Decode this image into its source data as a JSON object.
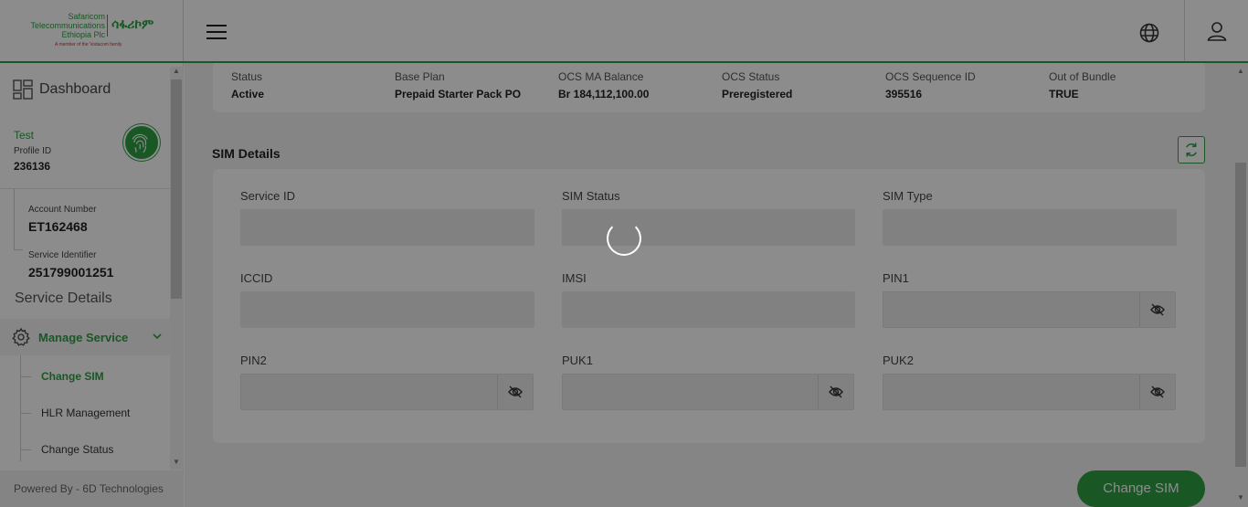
{
  "header": {
    "logo_lines": [
      "Safaricom",
      "Telecommunications",
      "Ethiopia Plc"
    ],
    "logo_amharic": "ሳፋሪኮም",
    "logo_sub": "A member of the Vodacom family",
    "menu_icon": "hamburger-icon",
    "language_icon": "globe-icon",
    "user_icon": "user-icon"
  },
  "sidebar": {
    "dashboard_label": "Dashboard",
    "profile_name": "Test",
    "profile_id_label": "Profile ID",
    "profile_id": "236136",
    "account_number_label": "Account Number",
    "account_number": "ET162468",
    "service_identifier_label": "Service Identifier",
    "service_identifier": "251799001251",
    "service_details_label": "Service Details",
    "manage_service_label": "Manage Service",
    "sub_items": [
      "Change SIM",
      "HLR Management",
      "Change Status"
    ],
    "active_sub_item": "Change SIM",
    "powered_by": "Powered By - 6D Technologies"
  },
  "summary": [
    {
      "label": "Status",
      "value": "Active"
    },
    {
      "label": "Base Plan",
      "value": "Prepaid Starter Pack PO"
    },
    {
      "label": "OCS MA Balance",
      "value": "Br 184,112,100.00"
    },
    {
      "label": "OCS Status",
      "value": "Preregistered"
    },
    {
      "label": "OCS Sequence ID",
      "value": "395516"
    },
    {
      "label": "Out of Bundle",
      "value": "TRUE"
    }
  ],
  "sim_details": {
    "title": "SIM Details",
    "fields": {
      "service_id": "Service ID",
      "sim_status": "SIM Status",
      "sim_type": "SIM Type",
      "iccid": "ICCID",
      "imsi": "IMSI",
      "pin1": "PIN1",
      "pin2": "PIN2",
      "puk1": "PUK1",
      "puk2": "PUK2"
    }
  },
  "actions": {
    "change_sim_label": "Change SIM"
  },
  "colors": {
    "brand_green": "#2e9e44",
    "overlay": "rgba(0,0,0,0.45)"
  }
}
